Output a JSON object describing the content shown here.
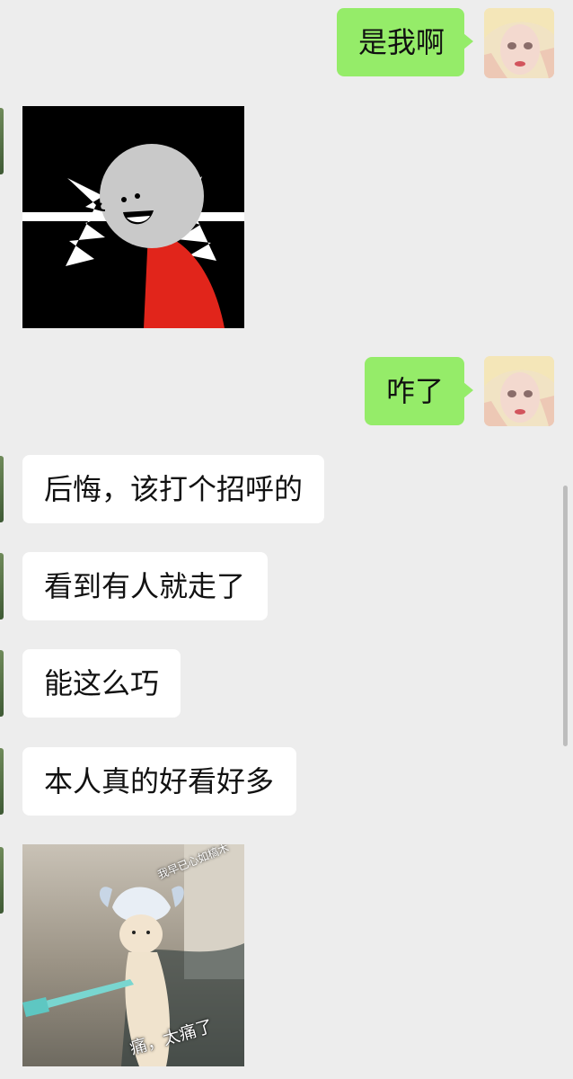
{
  "messages": [
    {
      "sender": "me",
      "type": "text",
      "text": "是我啊"
    },
    {
      "sender": "other",
      "type": "image",
      "image": "shocked-stickman-meme"
    },
    {
      "sender": "me",
      "type": "text",
      "text": "咋了"
    },
    {
      "sender": "other",
      "type": "text",
      "text": "后悔，该打个招呼的"
    },
    {
      "sender": "other",
      "type": "text",
      "text": "看到有人就走了"
    },
    {
      "sender": "other",
      "type": "text",
      "text": "能这么巧"
    },
    {
      "sender": "other",
      "type": "text",
      "text": "本人真的好看好多"
    },
    {
      "sender": "other",
      "type": "image",
      "image": "cat-cosplay-meme",
      "headline": "我早已心如槁木",
      "caption": "痛，太痛了"
    }
  ],
  "colors": {
    "background": "#ededed",
    "my_bubble": "#95ec69",
    "other_bubble": "#ffffff"
  }
}
